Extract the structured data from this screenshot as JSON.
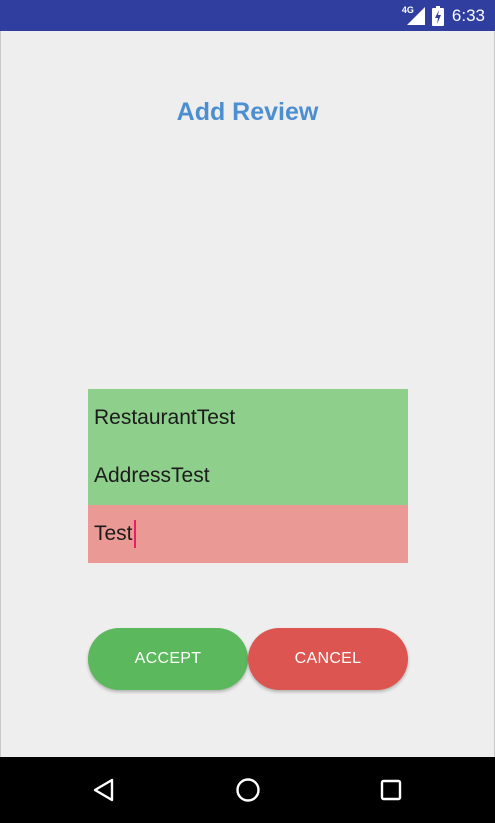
{
  "status_bar": {
    "network_label": "4G",
    "time": "6:33",
    "icons": [
      "signal-icon",
      "battery-charging-icon"
    ],
    "background_color": "#303f9f"
  },
  "page": {
    "title": "Add Review",
    "title_color": "#4b8fd0",
    "background_color": "#efeeee"
  },
  "form": {
    "restaurant_value": "RestaurantTest",
    "address_value": "AddressTest",
    "review_value": "Test",
    "valid_color": "#8ecf8c",
    "invalid_color": "#ea9994"
  },
  "actions": {
    "accept_label": "ACCEPT",
    "cancel_label": "CANCEL",
    "accept_color": "#5cb85c",
    "cancel_color": "#dd5550"
  },
  "nav_bar": {
    "icons": [
      "back-icon",
      "home-icon",
      "recents-icon"
    ]
  }
}
